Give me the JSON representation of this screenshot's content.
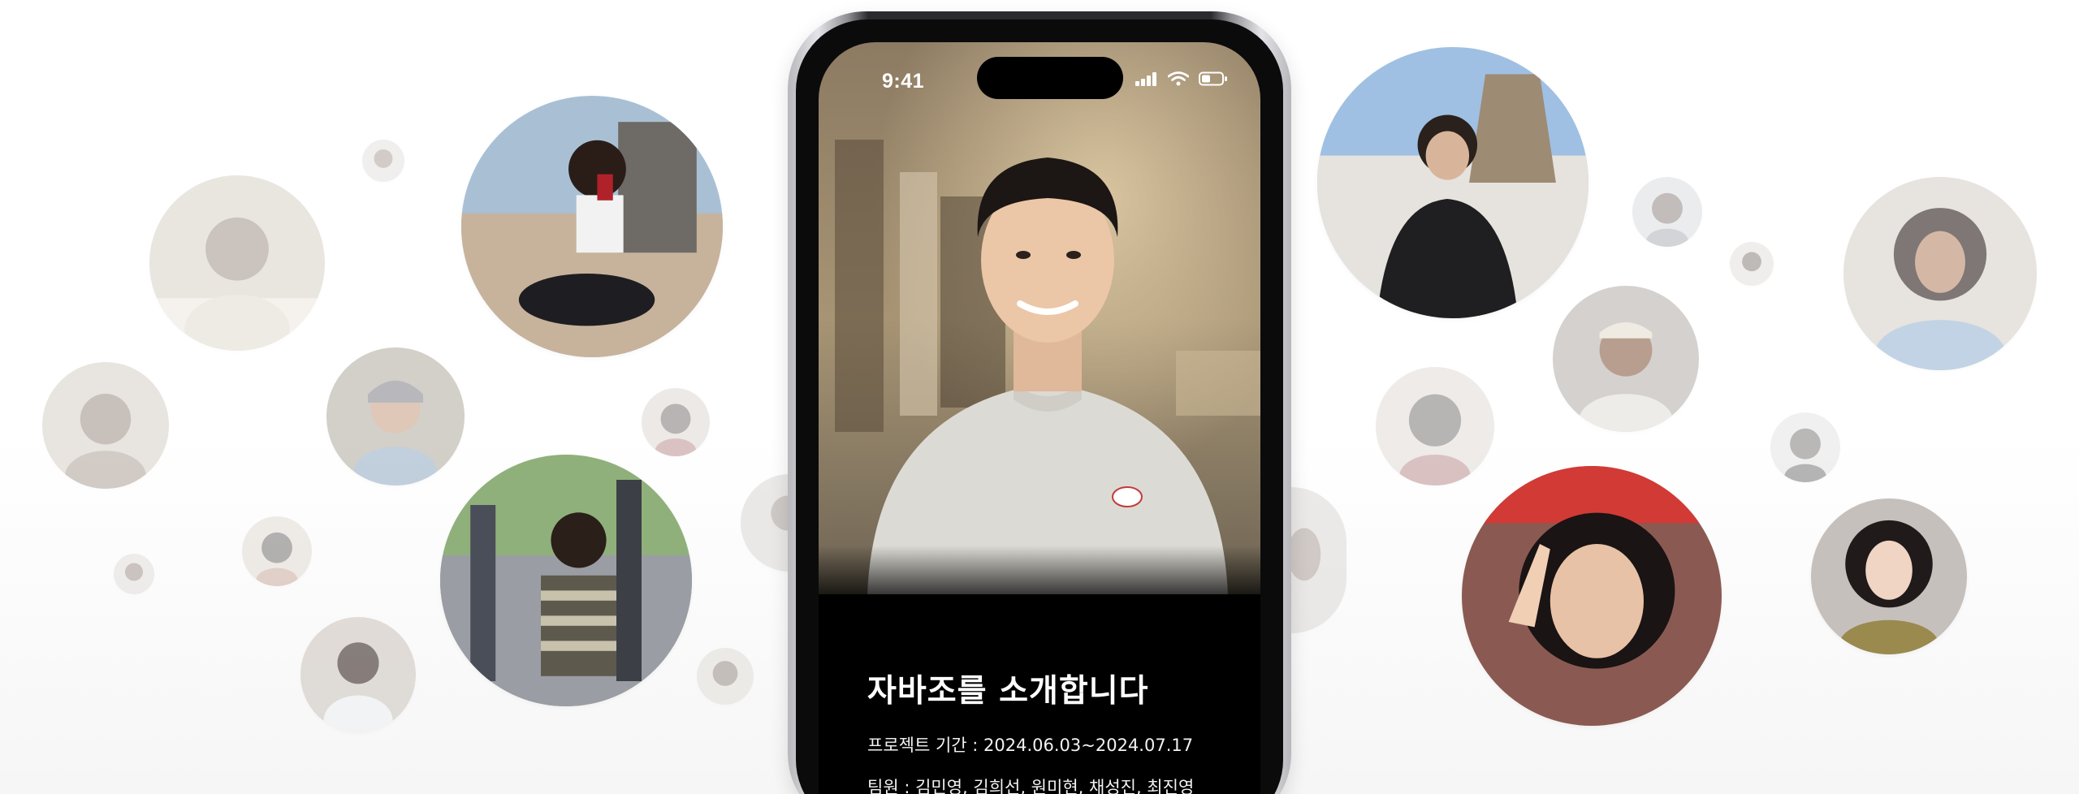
{
  "status_bar": {
    "time": "9:41",
    "icons": [
      "cellular-signal-icon",
      "wifi-icon",
      "battery-icon"
    ]
  },
  "intro": {
    "title": "자바조를 소개합니다",
    "period": "프로젝트 기간 : 2024.06.03~2024.07.17",
    "members": "팀원 : 김민영, 김희선, 원미현, 채성진, 최진영"
  },
  "theme": {
    "screen_background": "#000000",
    "text_color": "#ffffff",
    "page_background": "#ffffff"
  }
}
